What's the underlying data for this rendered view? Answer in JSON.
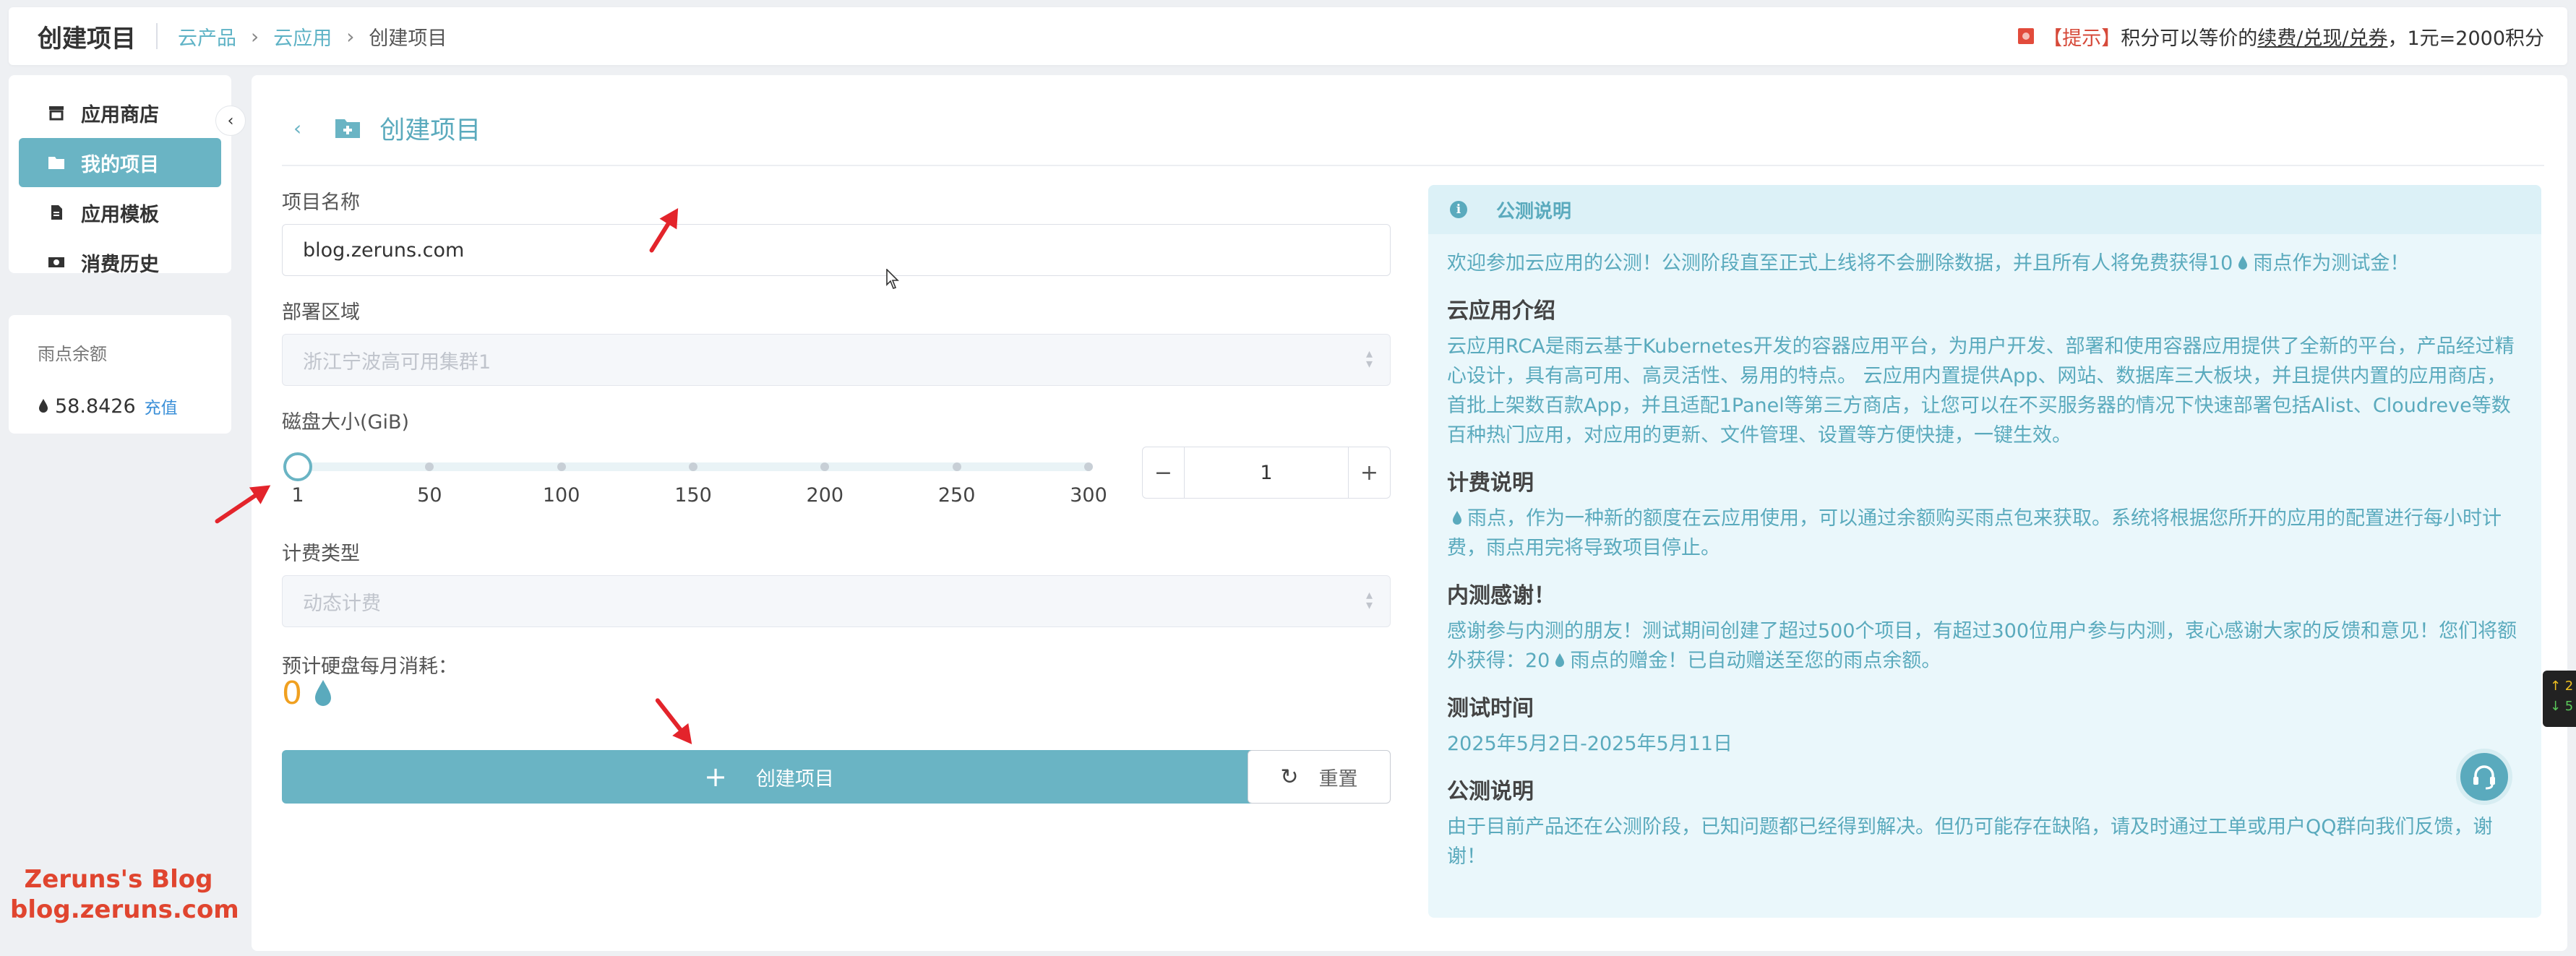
{
  "header": {
    "app_title": "创建项目",
    "breadcrumbs": [
      "云产品",
      "云应用",
      "创建项目"
    ],
    "notice": {
      "tag": "【提示】",
      "text_before": "积分可以等价的",
      "link": "续费/兑现/兑券",
      "text_after": "，1元=2000积分"
    }
  },
  "sidebar": {
    "items": [
      {
        "label": "应用商店",
        "icon": "store-icon"
      },
      {
        "label": "我的项目",
        "icon": "folder-icon"
      },
      {
        "label": "应用模板",
        "icon": "template-icon"
      },
      {
        "label": "消费历史",
        "icon": "money-icon"
      }
    ],
    "active_index": 1,
    "balance_label": "雨点余额",
    "balance_value": "58.8426",
    "recharge_label": "充值"
  },
  "form": {
    "page_title": "创建项目",
    "project_name_label": "项目名称",
    "project_name_value": "blog.zeruns.com",
    "region_label": "部署区域",
    "region_value": "浙江宁波高可用集群1",
    "disk_label": "磁盘大小(GiB)",
    "disk_ticks": [
      "1",
      "50",
      "100",
      "150",
      "200",
      "250",
      "300"
    ],
    "disk_value": "1",
    "disk_min": 1,
    "disk_max": 300,
    "billing_label": "计费类型",
    "billing_value": "动态计费",
    "cost_label": "预计硬盘每月消耗：",
    "cost_value": "0",
    "create_button": "创建项目",
    "reset_button": "重置"
  },
  "info": {
    "title": "公测说明",
    "intro_before": "欢迎参加云应用的公测！公测阶段直至正式上线将不会删除数据，并且所有人将免费获得10",
    "intro_after": "雨点作为测试金！",
    "sections": [
      {
        "heading": "云应用介绍",
        "text": "云应用RCA是雨云基于Kubernetes开发的容器应用平台，为用户开发、部署和使用容器应用提供了全新的平台，产品经过精心设计，具有高可用、高灵活性、易用的特点。 云应用内置提供App、网站、数据库三大板块，并且提供内置的应用商店，首批上架数百款App，并且适配1Panel等第三方商店，让您可以在不买服务器的情况下快速部署包括Alist、Cloudreve等数百种热门应用，对应用的更新、文件管理、设置等方便快捷，一键生效。"
      },
      {
        "heading": "计费说明",
        "text": "雨点，作为一种新的额度在云应用使用，可以通过余额购买雨点包来获取。系统将根据您所开的应用的配置进行每小时计费，雨点用完将导致项目停止。"
      },
      {
        "heading": "内测感谢！",
        "text_before": "感谢参与内测的朋友！测试期间创建了超过500个项目，有超过300位用户参与内测，衷心感谢大家的反馈和意见！您们将额外获得：20",
        "text_after": "雨点的赠金！已自动赠送至您的雨点余额。"
      },
      {
        "heading": "测试时间",
        "text": "2025年5月2日-2025年5月11日"
      },
      {
        "heading": "公测说明",
        "text": "由于目前产品还在公测阶段，已知问题都已经得到解决。但仍可能存在缺陷，请及时通过工单或用户QQ群向我们反馈，谢谢！"
      }
    ]
  },
  "side_widget": {
    "up": "↑ 2",
    "down": "↓ 5"
  },
  "watermark": {
    "line1": "Zeruns's Blog",
    "line2": "blog.zeruns.com"
  },
  "colors": {
    "accent": "#6ab4c4",
    "info_text": "#5aaabd",
    "info_bg": "#eaf7fb",
    "cost": "#f0a020",
    "arrow": "#e3242b"
  }
}
